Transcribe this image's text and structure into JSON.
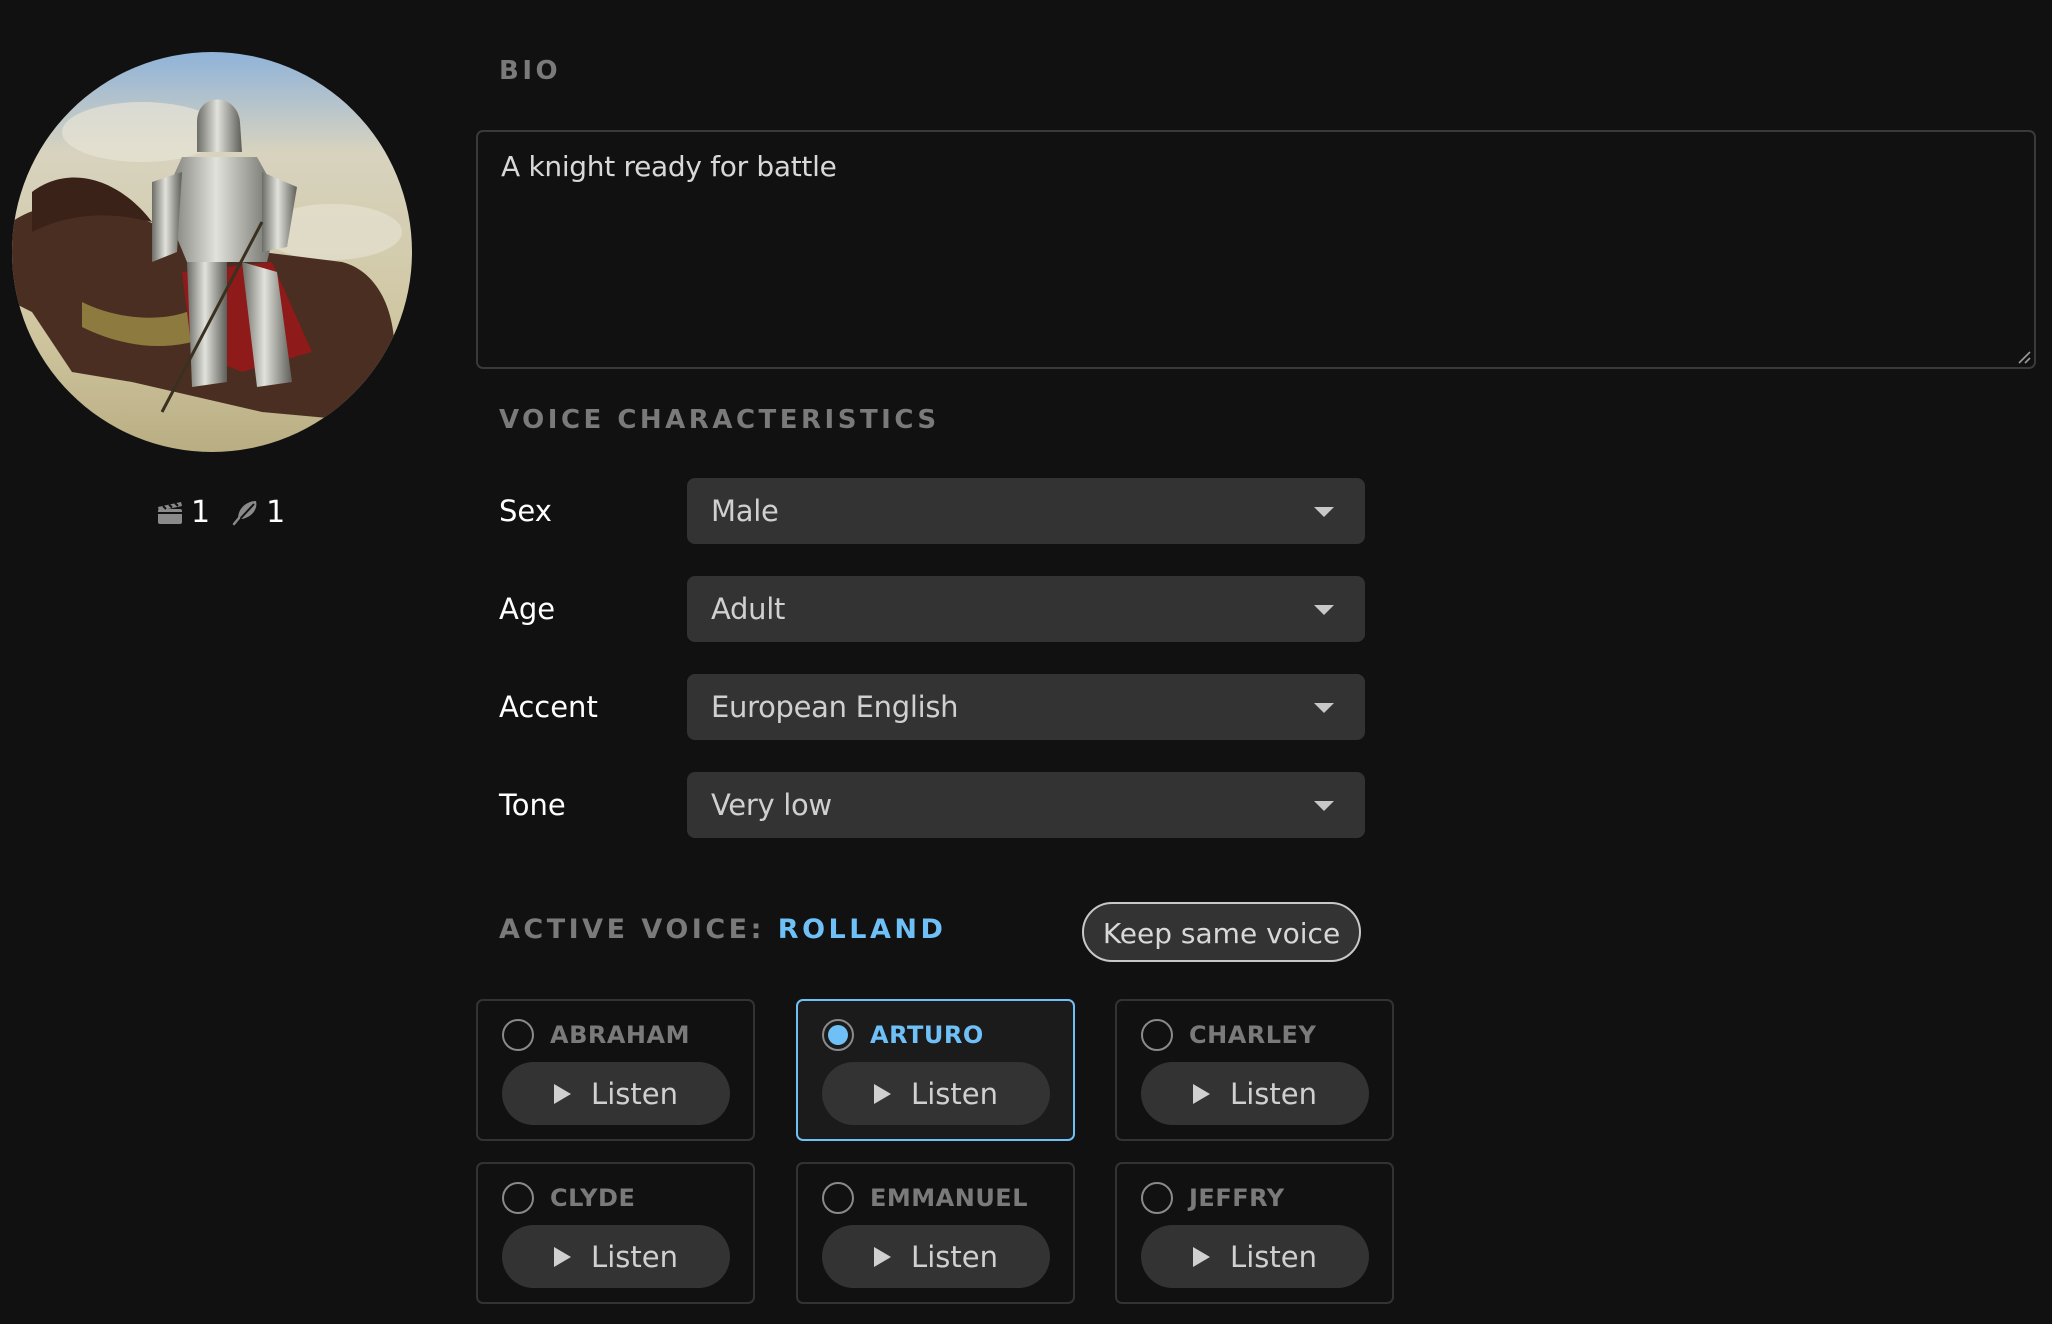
{
  "character": {
    "avatar_alt": "Knight in armor on horseback",
    "stats": [
      {
        "icon": "clapperboard-icon",
        "count": "1"
      },
      {
        "icon": "feather-icon",
        "count": "1"
      }
    ]
  },
  "bio": {
    "label": "BIO",
    "text": "A knight ready for battle"
  },
  "voice_characteristics": {
    "label": "VOICE CHARACTERISTICS",
    "fields": [
      {
        "label": "Sex",
        "value": "Male"
      },
      {
        "label": "Age",
        "value": "Adult"
      },
      {
        "label": "Accent",
        "value": "European English"
      },
      {
        "label": "Tone",
        "value": "Very low"
      }
    ]
  },
  "active_voice": {
    "prefix": "ACTIVE VOICE: ",
    "name": "ROLLAND",
    "keep_button": "Keep same voice"
  },
  "voices": [
    {
      "name": "ABRAHAM",
      "selected": false,
      "listen": "Listen"
    },
    {
      "name": "ARTURO",
      "selected": true,
      "listen": "Listen"
    },
    {
      "name": "CHARLEY",
      "selected": false,
      "listen": "Listen"
    },
    {
      "name": "CLYDE",
      "selected": false,
      "listen": "Listen"
    },
    {
      "name": "EMMANUEL",
      "selected": false,
      "listen": "Listen"
    },
    {
      "name": "JEFFRY",
      "selected": false,
      "listen": "Listen"
    }
  ],
  "colors": {
    "background": "#111111",
    "accent": "#6ec0f7",
    "muted_label": "#7a7a7a",
    "control_bg": "#333333"
  }
}
